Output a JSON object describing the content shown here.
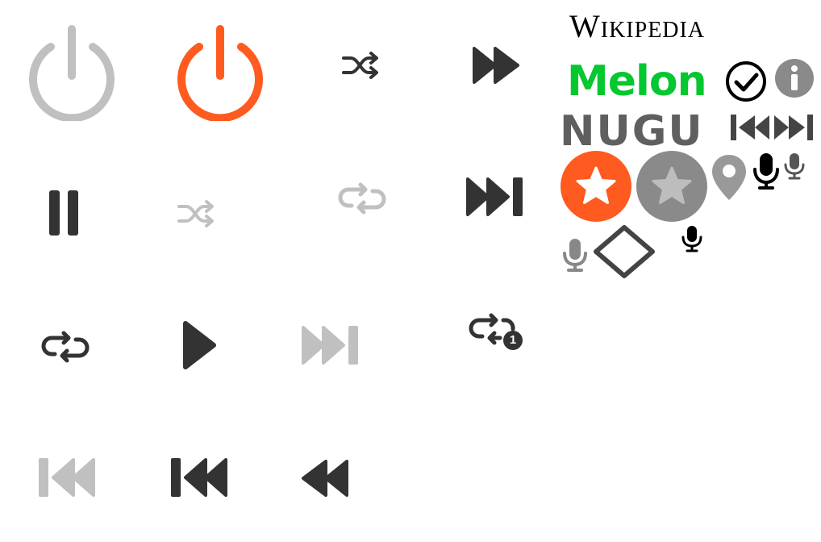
{
  "colors": {
    "dark": "#333333",
    "light": "#c0c0c0",
    "accent": "#ff5a1f",
    "melon_green": "#05c72f",
    "gray": "#8a8a8a"
  },
  "logos": {
    "wikipedia": "Wikipedia",
    "melon": "Melon",
    "nugu": "NUGU"
  },
  "badges": {
    "repeat_one": "1"
  },
  "icons": [
    "power-icon-disabled",
    "power-icon-active",
    "shuffle-icon",
    "fast-forward-icon",
    "pause-icon",
    "shuffle-icon-disabled",
    "repeat-icon-disabled",
    "skip-next-icon",
    "repeat-icon",
    "play-icon",
    "skip-next-icon-disabled",
    "repeat-one-icon",
    "skip-previous-icon-disabled",
    "skip-previous-icon",
    "rewind-icon",
    "check-circle-icon",
    "info-icon",
    "skip-previous-small-icon",
    "skip-next-small-icon",
    "star-circle-icon-active",
    "star-circle-icon-inactive",
    "location-pin-icon",
    "mic-icon",
    "mic-icon-light",
    "diamond-icon"
  ]
}
